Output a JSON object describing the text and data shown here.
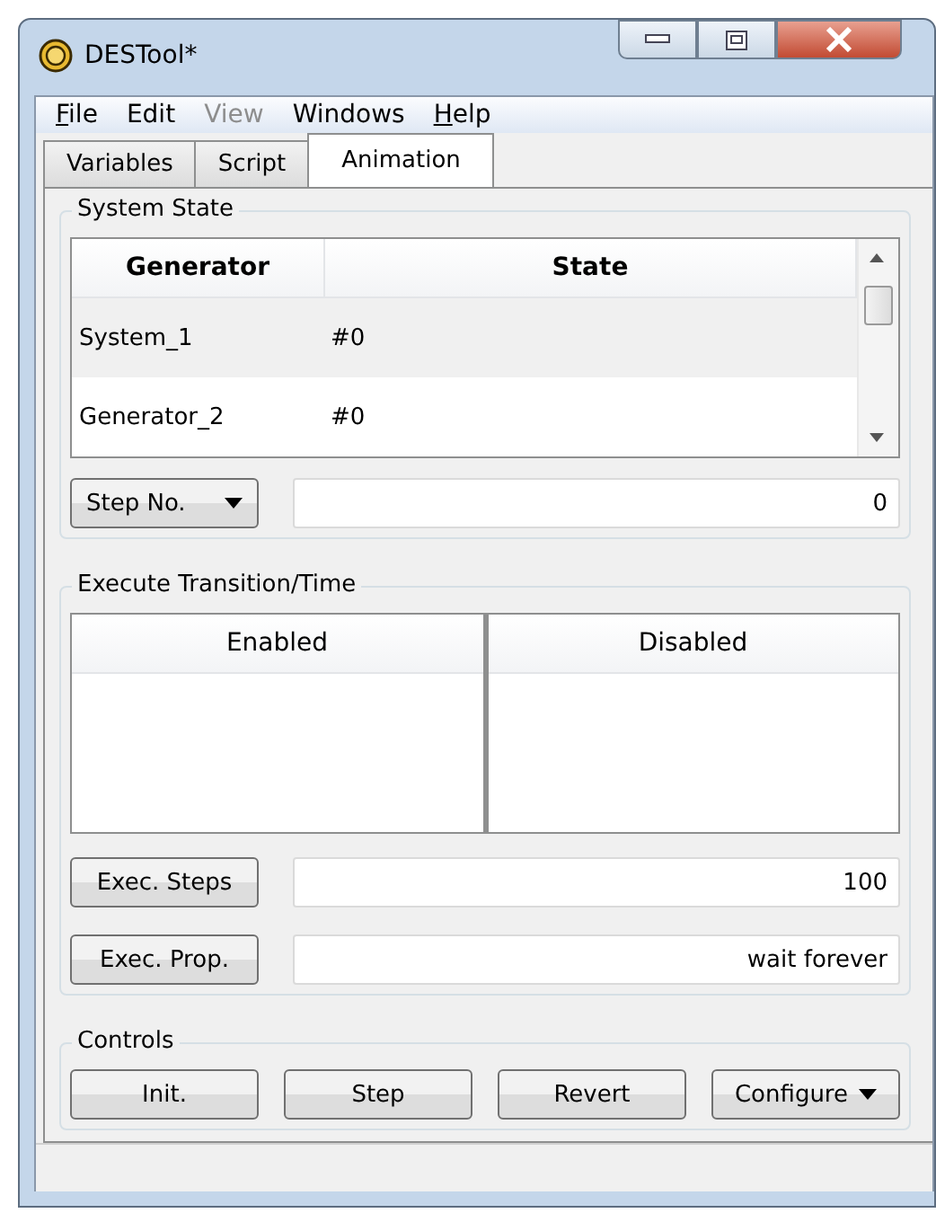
{
  "window": {
    "title": "DESTool*"
  },
  "menu": [
    {
      "label": "File",
      "underline_first": true,
      "disabled": false
    },
    {
      "label": "Edit",
      "underline_first": false,
      "disabled": false
    },
    {
      "label": "View",
      "underline_first": false,
      "disabled": true
    },
    {
      "label": "Windows",
      "underline_first": false,
      "disabled": false
    },
    {
      "label": "Help",
      "underline_first": true,
      "disabled": false
    }
  ],
  "tabs": [
    {
      "label": "Variables",
      "selected": false
    },
    {
      "label": "Script",
      "selected": false
    },
    {
      "label": "Animation",
      "selected": true
    }
  ],
  "system_state": {
    "title": "System State",
    "columns": [
      "Generator",
      "State"
    ],
    "rows": [
      {
        "cells": [
          "System_1",
          "#0"
        ],
        "selected": true
      },
      {
        "cells": [
          "Generator_2",
          "#0"
        ],
        "selected": false
      }
    ],
    "step_dropdown": "Step No.",
    "step_value": "0"
  },
  "execute": {
    "title": "Execute Transition/Time",
    "columns": [
      "Enabled",
      "Disabled"
    ],
    "fields": [
      {
        "button": "Exec. Steps",
        "value": "100"
      },
      {
        "button": "Exec. Prop.",
        "value": "wait forever"
      }
    ]
  },
  "controls": {
    "title": "Controls",
    "buttons": [
      {
        "label": "Init.",
        "kind": "plain"
      },
      {
        "label": "Step",
        "kind": "plain"
      },
      {
        "label": "Revert",
        "kind": "plain"
      },
      {
        "label": "Configure",
        "kind": "menu"
      }
    ]
  }
}
